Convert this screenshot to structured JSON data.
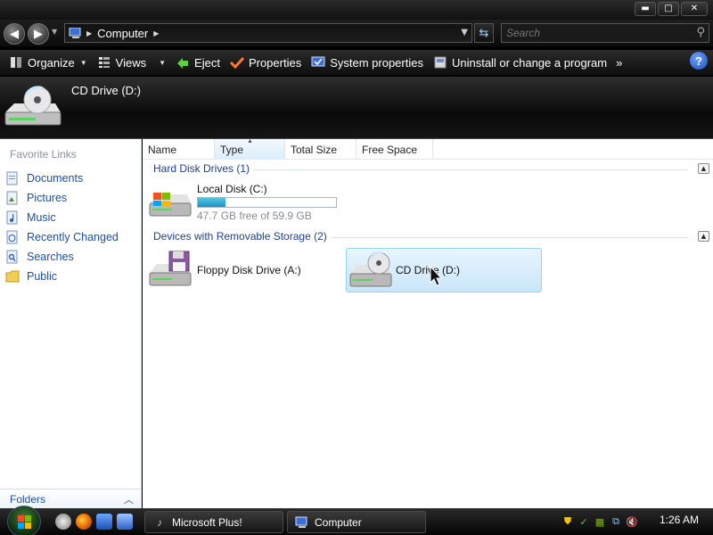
{
  "window": {
    "minimize": "▬",
    "maximize": "□",
    "close": "✕"
  },
  "address": {
    "crumb": "Computer",
    "search_placeholder": "Search"
  },
  "toolbar": {
    "organize": "Organize",
    "views": "Views",
    "eject": "Eject",
    "properties": "Properties",
    "system_properties": "System properties",
    "uninstall": "Uninstall or change a program",
    "more": "»",
    "help": "?"
  },
  "details": {
    "title": "CD Drive (D:)"
  },
  "sidebar": {
    "heading": "Favorite Links",
    "links": [
      {
        "label": "Documents",
        "icon": "documents-icon"
      },
      {
        "label": "Pictures",
        "icon": "pictures-icon"
      },
      {
        "label": "Music",
        "icon": "music-icon"
      },
      {
        "label": "Recently Changed",
        "icon": "recently-changed-icon"
      },
      {
        "label": "Searches",
        "icon": "searches-icon"
      },
      {
        "label": "Public",
        "icon": "public-folder-icon"
      }
    ],
    "folders_label": "Folders"
  },
  "columns": [
    "Name",
    "Type",
    "Total Size",
    "Free Space"
  ],
  "groups": {
    "hard_disks": {
      "title": "Hard Disk Drives (1)",
      "items": [
        {
          "name": "Local Disk (C:)",
          "free_text": "47.7 GB free of 59.9 GB",
          "used_fraction": 0.2
        }
      ]
    },
    "removable": {
      "title": "Devices with Removable Storage (2)",
      "items": [
        {
          "name": "Floppy Disk Drive (A:)"
        },
        {
          "name": "CD Drive (D:)",
          "selected": true
        }
      ]
    }
  },
  "taskbar": {
    "tasks": [
      {
        "label": "Microsoft Plus!"
      },
      {
        "label": "Computer"
      }
    ],
    "clock": "1:26 AM"
  },
  "colors": {
    "link": "#1e4fa3",
    "group_title": "#1e3f8f",
    "selection": "#c9e6fa",
    "usage_bar": "#1a8fc2"
  }
}
